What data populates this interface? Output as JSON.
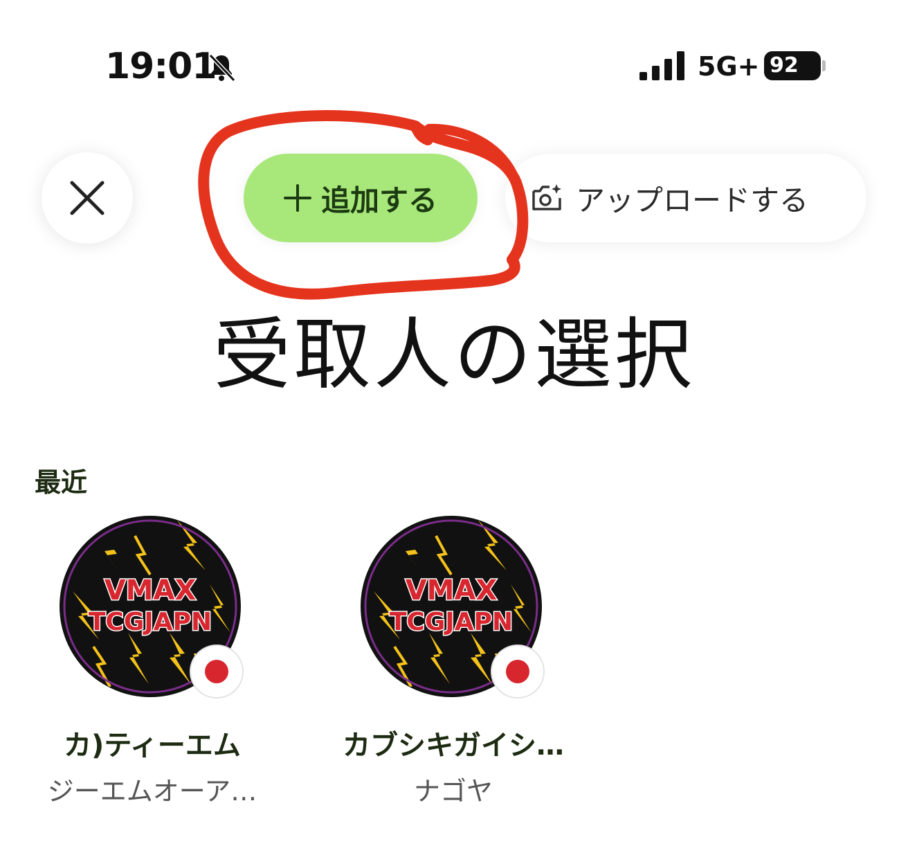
{
  "status_bar": {
    "time": "19:01",
    "network": "5G+",
    "battery": "92"
  },
  "actions": {
    "close_icon": "close-icon",
    "add_label": "追加する",
    "upload_label": "アップロードする"
  },
  "title": "受取人の選択",
  "recent": {
    "label": "最近",
    "contacts": [
      {
        "name": "カ)ティーエム",
        "sub": "ジーエムオーア…",
        "avatar_text_line1": "VMAX",
        "avatar_text_line2": "TCGJAPN",
        "flag": "japan-flag-icon"
      },
      {
        "name": "カブシキガイシ…",
        "sub": "ナゴヤ",
        "avatar_text_line1": "VMAX",
        "avatar_text_line2": "TCGJAPN",
        "flag": "japan-flag-icon"
      }
    ]
  },
  "colors": {
    "add_button": "#a8e87a",
    "highlight": "#e5341e",
    "flag_red": "#d8262f"
  }
}
